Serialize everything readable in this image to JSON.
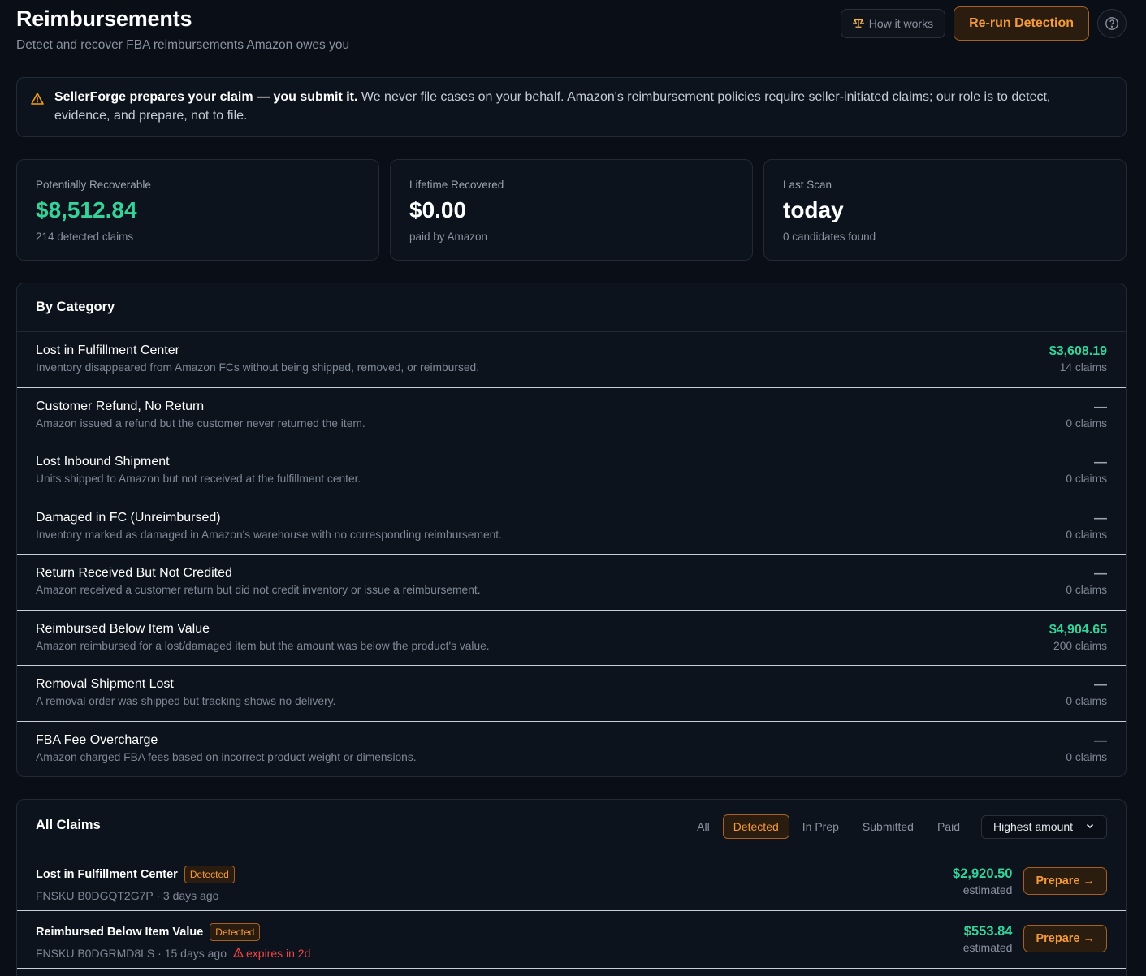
{
  "header": {
    "title": "Reimbursements",
    "subtitle": "Detect and recover FBA reimbursements Amazon owes you",
    "how_label": "How it works",
    "rerun_label": "Re-run Detection",
    "help_icon": "help-circle-icon"
  },
  "notice": {
    "bold": "SellerForge prepares your claim — you submit it.",
    "text": " We never file cases on your behalf. Amazon's reimbursement policies require seller-initiated claims; our role is to detect, evidence, and prepare, not to file."
  },
  "stats": [
    {
      "label": "Potentially Recoverable",
      "value": "$8,512.84",
      "sub": "214 detected claims"
    },
    {
      "label": "Lifetime Recovered",
      "value": "$0.00",
      "sub": "paid by Amazon"
    },
    {
      "label": "Last Scan",
      "value": "today",
      "sub": "0 candidates found"
    }
  ],
  "categories": {
    "title": "By Category",
    "items": [
      {
        "name": "Lost in Fulfillment Center",
        "desc": "Inventory disappeared from Amazon FCs without being shipped, removed, or reimbursed.",
        "amount": "$3,608.19",
        "claims": "14 claims"
      },
      {
        "name": "Customer Refund, No Return",
        "desc": "Amazon issued a refund but the customer never returned the item.",
        "amount": "—",
        "claims": "0 claims"
      },
      {
        "name": "Lost Inbound Shipment",
        "desc": "Units shipped to Amazon but not received at the fulfillment center.",
        "amount": "—",
        "claims": "0 claims"
      },
      {
        "name": "Damaged in FC (Unreimbursed)",
        "desc": "Inventory marked as damaged in Amazon's warehouse with no corresponding reimbursement.",
        "amount": "—",
        "claims": "0 claims"
      },
      {
        "name": "Return Received But Not Credited",
        "desc": "Amazon received a customer return but did not credit inventory or issue a reimbursement.",
        "amount": "—",
        "claims": "0 claims"
      },
      {
        "name": "Reimbursed Below Item Value",
        "desc": "Amazon reimbursed for a lost/damaged item but the amount was below the product's value.",
        "amount": "$4,904.65",
        "claims": "200 claims"
      },
      {
        "name": "Removal Shipment Lost",
        "desc": "A removal order was shipped but tracking shows no delivery.",
        "amount": "—",
        "claims": "0 claims"
      },
      {
        "name": "FBA Fee Overcharge",
        "desc": "Amazon charged FBA fees based on incorrect product weight or dimensions.",
        "amount": "—",
        "claims": "0 claims"
      }
    ]
  },
  "claims": {
    "title": "All Claims",
    "filters": [
      "All",
      "Detected",
      "In Prep",
      "Submitted",
      "Paid"
    ],
    "active_filter": "Detected",
    "sort_value": "Highest amount",
    "rows": [
      {
        "category": "Lost in Fulfillment Center",
        "badge": "Detected",
        "fnsku": "FNSKU B0DGQT2G7P",
        "age": "· 3 days ago",
        "expires": "",
        "amount": "$2,920.50",
        "est": "estimated",
        "action": "Prepare →"
      },
      {
        "category": "Reimbursed Below Item Value",
        "badge": "Detected",
        "fnsku": "FNSKU B0DGRMD8LS",
        "age": "· 15 days ago",
        "expires": "expires in 2d",
        "amount": "$553.84",
        "est": "estimated",
        "action": "Prepare →"
      }
    ]
  },
  "colors": {
    "accent": "#f59a3b",
    "positive": "#34d399",
    "danger": "#ef4444",
    "background": "#0a0f17"
  }
}
